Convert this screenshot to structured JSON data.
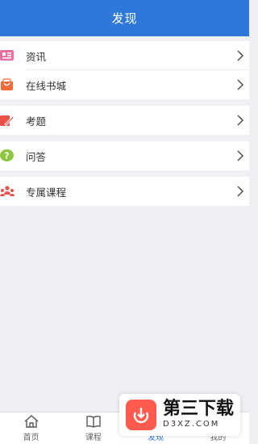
{
  "header": {
    "title": "发现"
  },
  "menu": {
    "items": [
      {
        "label": "资讯",
        "icon": "news-icon",
        "color": "#e86fa0"
      },
      {
        "label": "在线书城",
        "icon": "shopping-bag-icon",
        "color": "#f06a3a"
      },
      {
        "label": "考题",
        "icon": "pencil-icon",
        "color": "#e8504a"
      },
      {
        "label": "问答",
        "icon": "question-icon",
        "color": "#8cc63f"
      },
      {
        "label": "专属课程",
        "icon": "group-icon",
        "color": "#e8504a"
      }
    ]
  },
  "tabbar": {
    "tabs": [
      {
        "label": "首页",
        "icon": "home-icon"
      },
      {
        "label": "课程",
        "icon": "book-icon"
      },
      {
        "label": "发现",
        "icon": "discover-icon",
        "active": true
      },
      {
        "label": "我的",
        "icon": "profile-icon"
      }
    ]
  },
  "watermark": {
    "title": "第三下载",
    "subtitle": "D3XZ.COM"
  },
  "colors": {
    "brand": "#2d78d8",
    "background": "#eff0f4"
  }
}
